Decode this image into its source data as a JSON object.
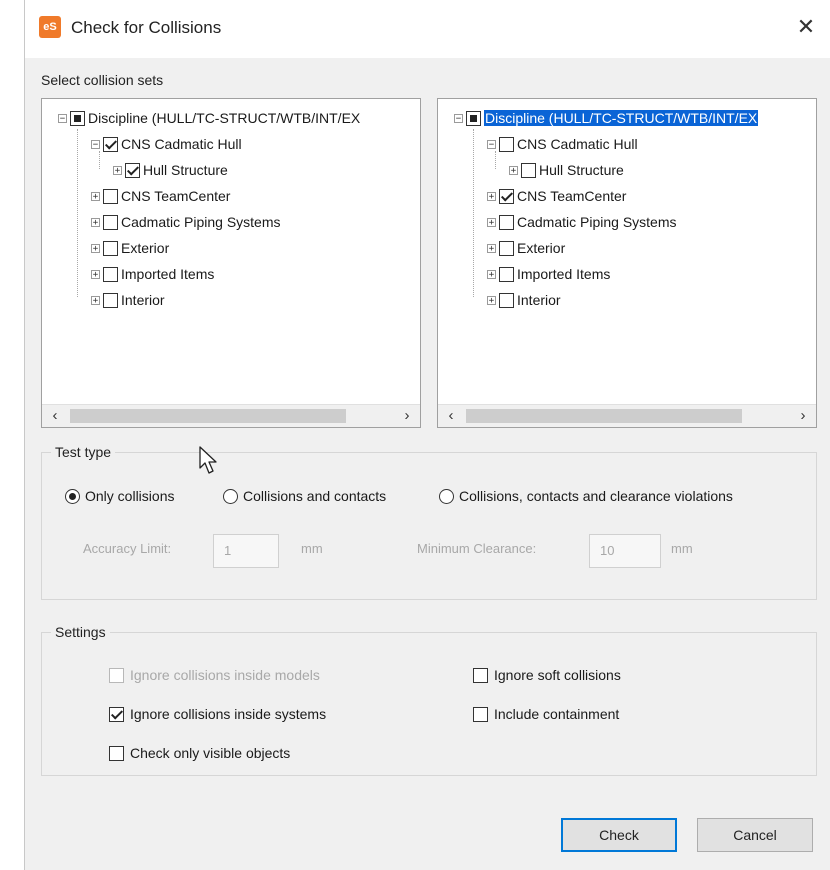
{
  "window": {
    "title": "Check for Collisions",
    "app_icon_text": "eS",
    "close_glyph": "✕"
  },
  "collision_sets": {
    "label": "Select collision sets",
    "left_tree": {
      "root": "Discipline (HULL/TC-STRUCT/WTB/INT/EX",
      "items": [
        {
          "label": "CNS Cadmatic Hull",
          "state": "checked",
          "expand": "−"
        },
        {
          "label": "Hull Structure",
          "state": "checked",
          "expand": "+"
        },
        {
          "label": "CNS TeamCenter",
          "state": "unchecked",
          "expand": "+"
        },
        {
          "label": "Cadmatic Piping Systems",
          "state": "unchecked",
          "expand": "+"
        },
        {
          "label": "Exterior",
          "state": "unchecked",
          "expand": "+"
        },
        {
          "label": "Imported Items",
          "state": "unchecked",
          "expand": "+"
        },
        {
          "label": "Interior",
          "state": "unchecked",
          "expand": "+"
        }
      ]
    },
    "right_tree": {
      "root": "Discipline (HULL/TC-STRUCT/WTB/INT/EX",
      "items": [
        {
          "label": "CNS Cadmatic Hull",
          "state": "unchecked",
          "expand": "−"
        },
        {
          "label": "Hull Structure",
          "state": "unchecked",
          "expand": "+"
        },
        {
          "label": "CNS TeamCenter",
          "state": "checked",
          "expand": "+"
        },
        {
          "label": "Cadmatic Piping Systems",
          "state": "unchecked",
          "expand": "+"
        },
        {
          "label": "Exterior",
          "state": "unchecked",
          "expand": "+"
        },
        {
          "label": "Imported Items",
          "state": "unchecked",
          "expand": "+"
        },
        {
          "label": "Interior",
          "state": "unchecked",
          "expand": "+"
        }
      ]
    },
    "scroll_left": "‹",
    "scroll_right": "›"
  },
  "test_type": {
    "label": "Test type",
    "options": [
      "Only collisions",
      "Collisions and contacts",
      "Collisions, contacts and clearance violations"
    ],
    "selected": "Only collisions",
    "accuracy_label": "Accuracy Limit:",
    "accuracy_value": "1",
    "accuracy_unit": "mm",
    "clearance_label": "Minimum Clearance:",
    "clearance_value": "10",
    "clearance_unit": "mm"
  },
  "settings": {
    "label": "Settings",
    "ignore_inside_models": "Ignore collisions inside models",
    "ignore_inside_systems": "Ignore collisions inside systems",
    "check_only_visible": "Check only visible objects",
    "ignore_soft": "Ignore soft collisions",
    "include_containment": "Include containment"
  },
  "buttons": {
    "check": "Check",
    "cancel": "Cancel"
  },
  "colors": {
    "selection": "#0a64d6",
    "accent": "#0078d7",
    "app_icon": "#f07a2a"
  }
}
